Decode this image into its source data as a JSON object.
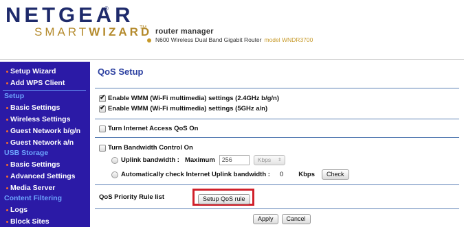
{
  "header": {
    "brand": "NETGEAR",
    "reg_mark": "®",
    "smart_light": "SMART",
    "smart_bold": "WIZARD",
    "tm": "TM",
    "router_manager": "router manager",
    "router_desc": "N600 Wireless Dual Band Gigabit Router",
    "model": "model WNDR3700",
    "accent_color": "#c79a2a",
    "brand_color": "#1e2a6b"
  },
  "sidebar": {
    "bg_color": "#2b1aa6",
    "items": [
      {
        "type": "item",
        "label": "Setup Wizard"
      },
      {
        "type": "item",
        "label": "Add WPS Client"
      },
      {
        "type": "heading",
        "label": "Setup"
      },
      {
        "type": "item",
        "label": "Basic Settings"
      },
      {
        "type": "item",
        "label": "Wireless Settings"
      },
      {
        "type": "item",
        "label": "Guest Network b/g/n"
      },
      {
        "type": "item",
        "label": "Guest Network a/n"
      },
      {
        "type": "heading",
        "label": "USB Storage"
      },
      {
        "type": "item",
        "label": "Basic Settings"
      },
      {
        "type": "item",
        "label": "Advanced Settings"
      },
      {
        "type": "item",
        "label": "Media Server"
      },
      {
        "type": "heading",
        "label": "Content Filtering"
      },
      {
        "type": "item",
        "label": "Logs"
      },
      {
        "type": "item",
        "label": "Block Sites"
      }
    ]
  },
  "main": {
    "title": "QoS Setup",
    "wmm_24": {
      "label": "Enable WMM (Wi-Fi multimedia) settings (2.4GHz b/g/n)",
      "checked": true
    },
    "wmm_5": {
      "label": "Enable WMM (Wi-Fi multimedia) settings (5GHz a/n)",
      "checked": true
    },
    "internet_qos": {
      "label": "Turn Internet Access QoS On",
      "checked": false
    },
    "bandwidth_control": {
      "label": "Turn Bandwidth Control On",
      "checked": false
    },
    "uplink": {
      "label": "Uplink bandwidth :",
      "max_label": "Maximum",
      "value": "256",
      "unit": "Kbps"
    },
    "auto_check": {
      "label": "Automatically check Internet Uplink bandwidth :",
      "value": "0",
      "unit": "Kbps",
      "button": "Check"
    },
    "priority_list": {
      "label": "QoS Priority Rule list",
      "button": "Setup QoS rule"
    },
    "apply_button": "Apply",
    "cancel_button": "Cancel",
    "highlight_color": "#d0202a"
  }
}
